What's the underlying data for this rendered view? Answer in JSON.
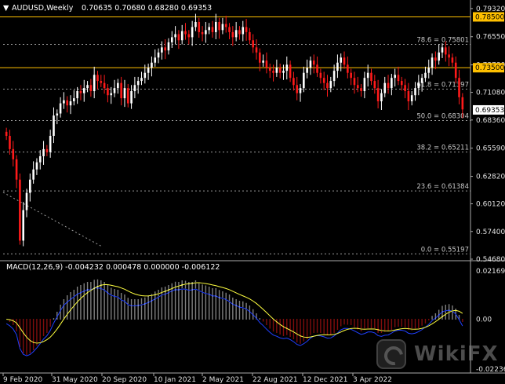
{
  "header": {
    "symbol": "AUDUSD,Weekly",
    "ohlc": "0.70635 0.70680 0.68280 0.69353",
    "macd": "MACD(12,26,9) -0.004232 0.000478 0.000000 -0.006122"
  },
  "price_axis": {
    "ticks": [
      "0.79320",
      "0.76550",
      "0.73780",
      "0.71080",
      "0.68360",
      "0.65590",
      "0.62820",
      "0.60120",
      "0.57400",
      "0.54680"
    ],
    "tick_values": [
      0.7932,
      0.7655,
      0.7378,
      0.7108,
      0.6836,
      0.6559,
      0.6282,
      0.6012,
      0.574,
      0.5468
    ],
    "range": [
      0.5468,
      0.7985
    ],
    "tag_785": "0.78500",
    "tag_735": "0.73500",
    "tag_current": "0.69353"
  },
  "macd_axis": {
    "ticks": [
      "0.021695",
      "0.00",
      "-0.022368"
    ],
    "tick_values": [
      0.021695,
      0.0,
      -0.022368
    ]
  },
  "fib_levels": [
    {
      "label": "78.6 = 0.75801",
      "value": 0.75801
    },
    {
      "label": "61.8 = 0.71397",
      "value": 0.71397
    },
    {
      "label": "50.0 = 0.68304",
      "value": 0.68304
    },
    {
      "label": "38.2 = 0.65211",
      "value": 0.65211
    },
    {
      "label": "23.6 = 0.61384",
      "value": 0.61384
    },
    {
      "label": "0.0 = 0.55197",
      "value": 0.55197
    }
  ],
  "horizontal_lines": [
    0.785,
    0.735
  ],
  "time_axis": [
    "9 Feb 2020",
    "31 May 2020",
    "20 Sep 2020",
    "10 Jan 2021",
    "2 May 2021",
    "22 Aug 2021",
    "12 Dec 2021",
    "3 Apr 2022"
  ],
  "watermark": "WikiFX",
  "colors": {
    "bull": "#ffffff",
    "bear": "#ff1a1a",
    "fib": "#9a9a9a",
    "hline": "#ffc000",
    "macd_hist_pos": "#ffffff",
    "macd_hist_neg": "#ff1a1a",
    "signal": "#ffff40",
    "main": "#2040ff"
  },
  "chart_data": {
    "type": "candlestick",
    "closes": [
      0.668,
      0.655,
      0.645,
      0.625,
      0.565,
      0.595,
      0.612,
      0.625,
      0.635,
      0.642,
      0.648,
      0.655,
      0.652,
      0.668,
      0.688,
      0.69,
      0.7,
      0.703,
      0.698,
      0.702,
      0.705,
      0.712,
      0.71,
      0.715,
      0.718,
      0.712,
      0.728,
      0.722,
      0.72,
      0.715,
      0.708,
      0.71,
      0.715,
      0.72,
      0.705,
      0.715,
      0.7,
      0.712,
      0.718,
      0.722,
      0.725,
      0.73,
      0.735,
      0.74,
      0.745,
      0.75,
      0.755,
      0.752,
      0.76,
      0.765,
      0.768,
      0.762,
      0.771,
      0.768,
      0.765,
      0.775,
      0.78,
      0.77,
      0.768,
      0.772,
      0.775,
      0.77,
      0.78,
      0.772,
      0.778,
      0.775,
      0.77,
      0.765,
      0.772,
      0.768,
      0.775,
      0.77,
      0.762,
      0.755,
      0.75,
      0.74,
      0.742,
      0.735,
      0.732,
      0.73,
      0.735,
      0.73,
      0.732,
      0.738,
      0.725,
      0.718,
      0.71,
      0.715,
      0.73,
      0.735,
      0.742,
      0.738,
      0.73,
      0.725,
      0.72,
      0.715,
      0.722,
      0.732,
      0.74,
      0.745,
      0.738,
      0.73,
      0.725,
      0.718,
      0.715,
      0.712,
      0.725,
      0.73,
      0.722,
      0.715,
      0.702,
      0.71,
      0.72,
      0.715,
      0.725,
      0.728,
      0.722,
      0.718,
      0.712,
      0.702,
      0.708,
      0.715,
      0.72,
      0.725,
      0.73,
      0.735,
      0.745,
      0.742,
      0.75,
      0.755,
      0.748,
      0.745,
      0.74,
      0.725,
      0.706,
      0.694
    ],
    "macd_hist_range": [
      -0.022368,
      0.021695
    ]
  }
}
